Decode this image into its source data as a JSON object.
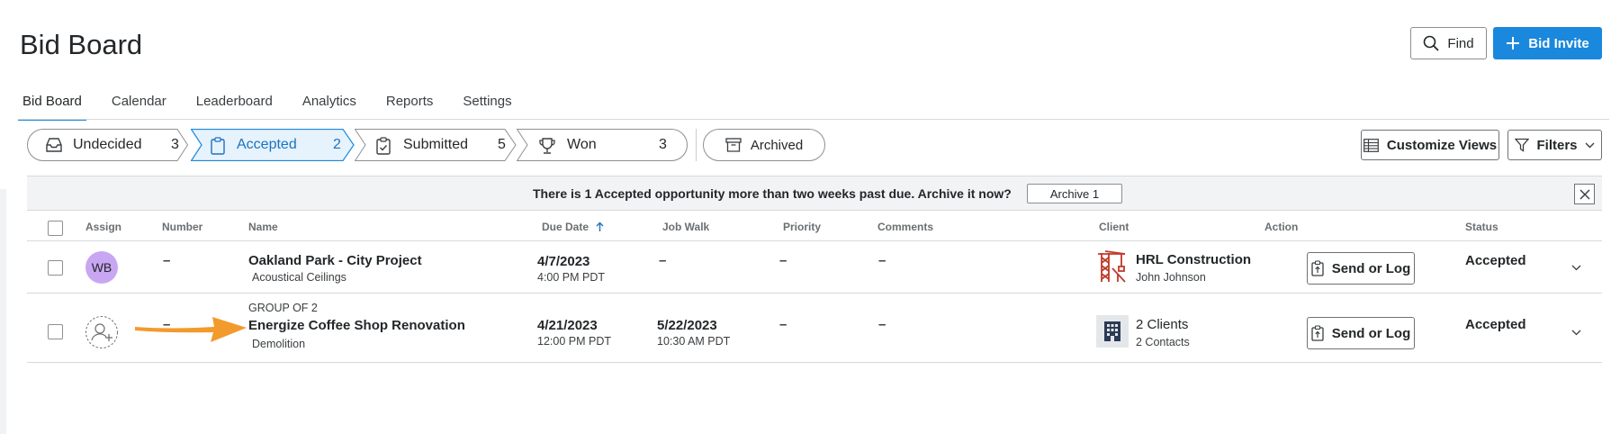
{
  "header": {
    "title": "Bid Board",
    "find_label": "Find",
    "bid_invite_label": "Bid Invite"
  },
  "tabs": [
    {
      "label": "Bid Board",
      "active": true
    },
    {
      "label": "Calendar"
    },
    {
      "label": "Leaderboard"
    },
    {
      "label": "Analytics"
    },
    {
      "label": "Reports"
    },
    {
      "label": "Settings"
    }
  ],
  "pipeline": [
    {
      "label": "Undecided",
      "count": "3",
      "icon": "inbox-icon"
    },
    {
      "label": "Accepted",
      "count": "2",
      "icon": "clipboard-icon",
      "active": true
    },
    {
      "label": "Submitted",
      "count": "5",
      "icon": "clipboard-check-icon"
    },
    {
      "label": "Won",
      "count": "3",
      "icon": "trophy-icon"
    }
  ],
  "archived_label": "Archived",
  "toolbar": {
    "customize_label": "Customize Views",
    "filters_label": "Filters"
  },
  "banner": {
    "text": "There is 1 Accepted opportunity more than two weeks past due. Archive it now?",
    "button_label": "Archive 1"
  },
  "columns": [
    "Assign",
    "Number",
    "Name",
    "Due Date",
    "Job Walk",
    "Priority",
    "Comments",
    "Client",
    "Action",
    "Status"
  ],
  "rows": [
    {
      "assign": "WB",
      "number": "–",
      "group": "",
      "name": "Oakland Park - City Project",
      "trade": "Acoustical Ceilings",
      "due_date": "4/7/2023",
      "due_time": "4:00 PM PDT",
      "job_walk_date": "–",
      "job_walk_time": "",
      "priority": "–",
      "comments": "–",
      "client": "HRL Construction",
      "contact": "John Johnson",
      "action": "Send or Log",
      "status": "Accepted"
    },
    {
      "assign": "",
      "number": "–",
      "group": "GROUP OF 2",
      "name": "Energize Coffee Shop Renovation",
      "trade": "Demolition",
      "due_date": "4/21/2023",
      "due_time": "12:00 PM PDT",
      "job_walk_date": "5/22/2023",
      "job_walk_time": "10:30 AM PDT",
      "priority": "–",
      "comments": "–",
      "client": "2 Clients",
      "contact": "2 Contacts",
      "action": "Send or Log",
      "status": "Accepted"
    }
  ],
  "colors": {
    "accent": "#1a88dc",
    "avatar": "#c9a6f2",
    "client_logo": "#c0392b",
    "arrow": "#f39a2c"
  }
}
